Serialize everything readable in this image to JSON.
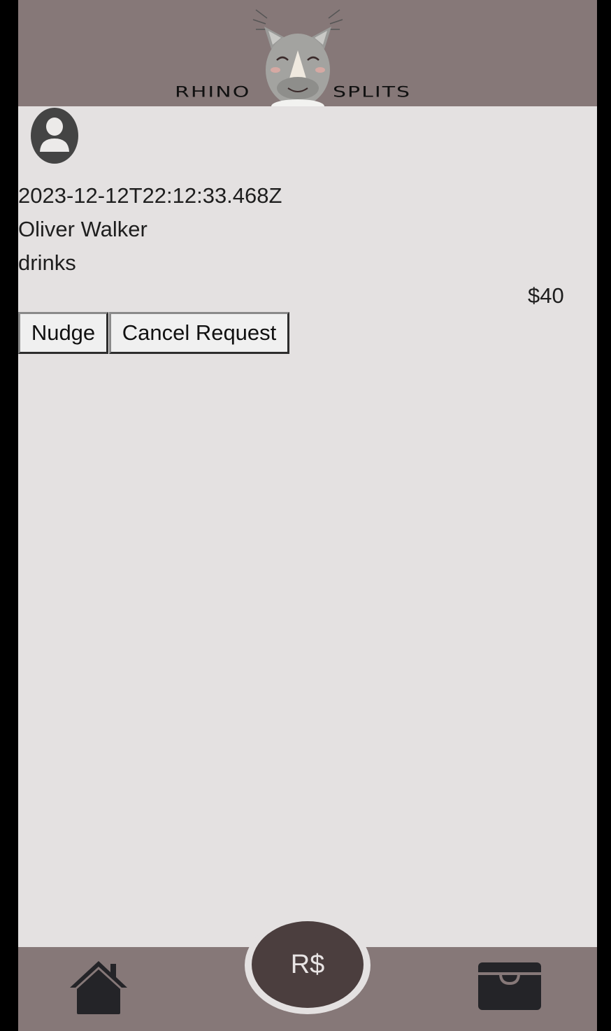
{
  "header": {
    "logo_left": "RHINO",
    "logo_right": "SPLITS"
  },
  "request": {
    "avatar_icon": "user-avatar-icon",
    "date": "2023-12-12T22:12:33.468Z",
    "name": "Oliver Walker",
    "description": "drinks",
    "amount": "$40"
  },
  "actions": {
    "nudge_label": "Nudge",
    "cancel_label": "Cancel Request"
  },
  "footer": {
    "home_icon": "home-icon",
    "center_label": "R$",
    "wallet_icon": "wallet-icon"
  },
  "colors": {
    "header_bg": "#867878",
    "content_bg": "#e4e1e1",
    "center_button_bg": "#4b3e3e"
  }
}
